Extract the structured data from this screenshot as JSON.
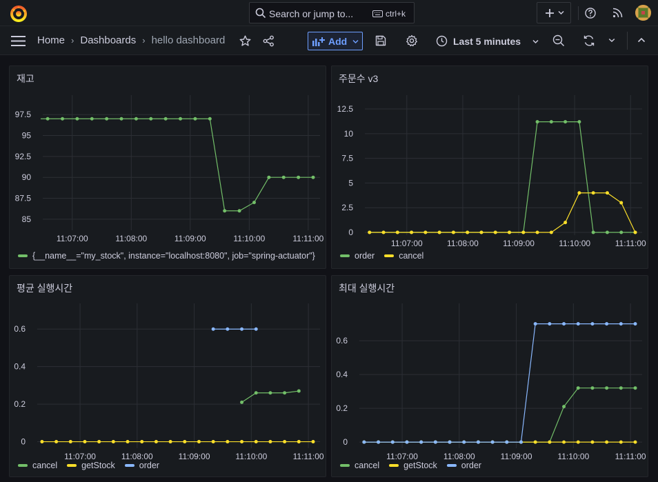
{
  "topbar": {
    "search_placeholder": "Search or jump to...",
    "search_shortcut": "ctrl+k",
    "icons": [
      "grafana-logo-icon",
      "search-icon",
      "keyboard-icon",
      "plus-icon",
      "chevron-down-icon",
      "help-icon",
      "rss-icon",
      "avatar"
    ]
  },
  "breadcrumb": {
    "home": "Home",
    "dashboards": "Dashboards",
    "current": "hello dashboard"
  },
  "toolbar": {
    "add_label": "Add",
    "time_range": "Last 5 minutes"
  },
  "colors": {
    "green": "#73bf69",
    "yellow": "#fade2a",
    "blue": "#8ab8ff",
    "accent": "#6e9fff"
  },
  "x_ticks": [
    "11:07:00",
    "11:08:00",
    "11:09:00",
    "11:10:00",
    "11:11:00"
  ],
  "panels": [
    {
      "title": "재고",
      "legend": [
        "{__name__=\"my_stock\", instance=\"localhost:8080\", job=\"spring-actuator\"}"
      ],
      "chart_data": {
        "type": "line",
        "ylim": [
          84,
          99
        ],
        "yticks": [
          "97.5",
          "95",
          "92.5",
          "90",
          "87.5",
          "85"
        ],
        "ytick_values": [
          97.5,
          95,
          92.5,
          90,
          87.5,
          85
        ],
        "x": [
          "11:06:35",
          "11:06:50",
          "11:07:05",
          "11:07:20",
          "11:07:35",
          "11:07:50",
          "11:08:05",
          "11:08:20",
          "11:08:35",
          "11:08:50",
          "11:09:05",
          "11:09:20",
          "11:09:35",
          "11:09:50",
          "11:10:05",
          "11:10:20",
          "11:10:35",
          "11:10:50",
          "11:11:05"
        ],
        "series": [
          {
            "name": "{__name__=\"my_stock\", instance=\"localhost:8080\", job=\"spring-actuator\"}",
            "color": "#73bf69",
            "values": [
              97,
              97,
              97,
              97,
              97,
              97,
              97,
              97,
              97,
              97,
              97,
              97,
              86,
              86,
              87,
              90,
              90,
              90,
              90
            ]
          }
        ]
      }
    },
    {
      "title": "주문수 v3",
      "legend": [
        "order",
        "cancel"
      ],
      "chart_data": {
        "type": "line",
        "ylim": [
          0,
          13.2
        ],
        "yticks": [
          "12.5",
          "10",
          "7.5",
          "5",
          "2.5",
          "0"
        ],
        "ytick_values": [
          12.5,
          10,
          7.5,
          5,
          2.5,
          0
        ],
        "x": [
          "11:06:20",
          "11:06:35",
          "11:06:50",
          "11:07:05",
          "11:07:20",
          "11:07:35",
          "11:07:50",
          "11:08:05",
          "11:08:20",
          "11:08:35",
          "11:08:50",
          "11:09:05",
          "11:09:20",
          "11:09:35",
          "11:09:50",
          "11:10:05",
          "11:10:20",
          "11:10:35",
          "11:10:50",
          "11:11:05"
        ],
        "series": [
          {
            "name": "order",
            "color": "#73bf69",
            "values": [
              0,
              0,
              0,
              0,
              0,
              0,
              0,
              0,
              0,
              0,
              0,
              0,
              11.2,
              11.2,
              11.2,
              11.2,
              0,
              0,
              0,
              0
            ]
          },
          {
            "name": "cancel",
            "color": "#fade2a",
            "values": [
              0,
              0,
              0,
              0,
              0,
              0,
              0,
              0,
              0,
              0,
              0,
              0,
              0,
              0,
              1,
              4,
              4,
              4,
              3,
              0
            ]
          }
        ]
      }
    },
    {
      "title": "평균 실행시간",
      "legend": [
        "cancel",
        "getStock",
        "order"
      ],
      "chart_data": {
        "type": "line",
        "ylim": [
          -0.02,
          0.7
        ],
        "yticks": [
          "0.6",
          "0.4",
          "0.2",
          "0"
        ],
        "ytick_values": [
          0.6,
          0.4,
          0.2,
          0
        ],
        "x": [
          "11:06:20",
          "11:06:35",
          "11:06:50",
          "11:07:05",
          "11:07:20",
          "11:07:35",
          "11:07:50",
          "11:08:05",
          "11:08:20",
          "11:08:35",
          "11:08:50",
          "11:09:05",
          "11:09:20",
          "11:09:35",
          "11:09:50",
          "11:10:05",
          "11:10:20",
          "11:10:35",
          "11:10:50",
          "11:11:05"
        ],
        "series": [
          {
            "name": "cancel",
            "color": "#73bf69",
            "values": [
              null,
              null,
              null,
              null,
              null,
              null,
              null,
              null,
              null,
              null,
              null,
              null,
              null,
              null,
              0.21,
              0.26,
              0.26,
              0.26,
              0.27,
              null
            ]
          },
          {
            "name": "getStock",
            "color": "#fade2a",
            "values": [
              0,
              0,
              0,
              0,
              0,
              0,
              0,
              0,
              0,
              0,
              0,
              0,
              0,
              0,
              0,
              0,
              0,
              0,
              0,
              0
            ]
          },
          {
            "name": "order",
            "color": "#8ab8ff",
            "values": [
              null,
              null,
              null,
              null,
              null,
              null,
              null,
              null,
              null,
              null,
              null,
              null,
              0.6,
              0.6,
              0.6,
              0.6,
              null,
              null,
              null,
              null
            ]
          }
        ]
      }
    },
    {
      "title": "최대 실행시간",
      "legend": [
        "cancel",
        "getStock",
        "order"
      ],
      "chart_data": {
        "type": "line",
        "ylim": [
          -0.02,
          0.78
        ],
        "yticks": [
          "0.6",
          "0.4",
          "0.2",
          "0"
        ],
        "ytick_values": [
          0.6,
          0.4,
          0.2,
          0
        ],
        "x": [
          "11:06:20",
          "11:06:35",
          "11:06:50",
          "11:07:05",
          "11:07:20",
          "11:07:35",
          "11:07:50",
          "11:08:05",
          "11:08:20",
          "11:08:35",
          "11:08:50",
          "11:09:05",
          "11:09:20",
          "11:09:35",
          "11:09:50",
          "11:10:05",
          "11:10:20",
          "11:10:35",
          "11:10:50",
          "11:11:05"
        ],
        "series": [
          {
            "name": "cancel",
            "color": "#73bf69",
            "values": [
              0,
              0,
              0,
              0,
              0,
              0,
              0,
              0,
              0,
              0,
              0,
              0,
              0,
              0,
              0.21,
              0.32,
              0.32,
              0.32,
              0.32,
              0.32
            ]
          },
          {
            "name": "getStock",
            "color": "#fade2a",
            "values": [
              0,
              0,
              0,
              0,
              0,
              0,
              0,
              0,
              0,
              0,
              0,
              0,
              0,
              0,
              0,
              0,
              0,
              0,
              0,
              0
            ]
          },
          {
            "name": "order",
            "color": "#8ab8ff",
            "values": [
              0,
              0,
              0,
              0,
              0,
              0,
              0,
              0,
              0,
              0,
              0,
              0,
              0.7,
              0.7,
              0.7,
              0.7,
              0.7,
              0.7,
              0.7,
              0.7
            ]
          }
        ]
      }
    }
  ]
}
